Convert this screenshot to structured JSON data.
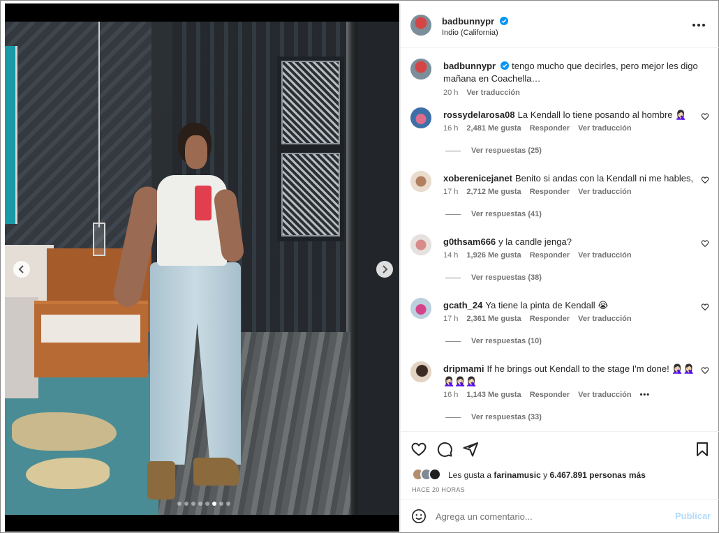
{
  "post": {
    "author": "badbunnypr",
    "location": "Indio (California)",
    "caption": "tengo mucho que decirles, pero mejor les digo mañana en Coachella…",
    "caption_time": "20 h",
    "see_translation": "Ver traducción"
  },
  "carousel": {
    "slide_count": 8,
    "active_index": 5
  },
  "comments": [
    {
      "user": "rossydelarosa08",
      "text": "La Kendall lo tiene posando al hombre 🤦🏻‍♀️",
      "time": "16 h",
      "likes": "2,481 Me gusta",
      "reply": "Responder",
      "translate": "Ver traducción",
      "replies": "Ver respuestas (25)"
    },
    {
      "user": "xoberenicejanet",
      "text": "Benito si andas con la Kendall ni me hables,",
      "time": "17 h",
      "likes": "2,712 Me gusta",
      "reply": "Responder",
      "translate": "Ver traducción",
      "replies": "Ver respuestas (41)"
    },
    {
      "user": "g0thsam666",
      "text": "y la candle jenga?",
      "time": "14 h",
      "likes": "1,926 Me gusta",
      "reply": "Responder",
      "translate": "Ver traducción",
      "replies": "Ver respuestas (38)"
    },
    {
      "user": "gcath_24",
      "text": "Ya tiene la pinta de Kendall 😭",
      "time": "17 h",
      "likes": "2,361 Me gusta",
      "reply": "Responder",
      "translate": "Ver traducción",
      "replies": "Ver respuestas (10)"
    },
    {
      "user": "dripmami",
      "text": "If he brings out Kendall to the stage I'm done! 🤦🏻‍♀️🤦🏻‍♀️ 🤦🏻‍♀️🤦🏻‍♀️🤦🏻‍♀️",
      "time": "16 h",
      "likes": "1,143 Me gusta",
      "reply": "Responder",
      "translate": "Ver traducción",
      "more": "•••",
      "replies": "Ver respuestas (33)"
    }
  ],
  "likes": {
    "prefix": "Les gusta a",
    "user": "farinamusic",
    "connector": "y",
    "count": "6.467.891 personas más"
  },
  "time_ago": "HACE 20 HORAS",
  "add_comment": {
    "placeholder": "Agrega un comentario...",
    "publish_label": "Publicar"
  },
  "colors": {
    "verified": "#0095f6",
    "publish_disabled": "#b3dbff",
    "secondary_text": "#737373"
  },
  "icons": [
    "more-options-icon",
    "verified-badge-icon",
    "heart-icon",
    "comment-icon",
    "share-icon",
    "save-icon",
    "emoji-icon",
    "chevron-left-icon",
    "chevron-right-icon"
  ]
}
